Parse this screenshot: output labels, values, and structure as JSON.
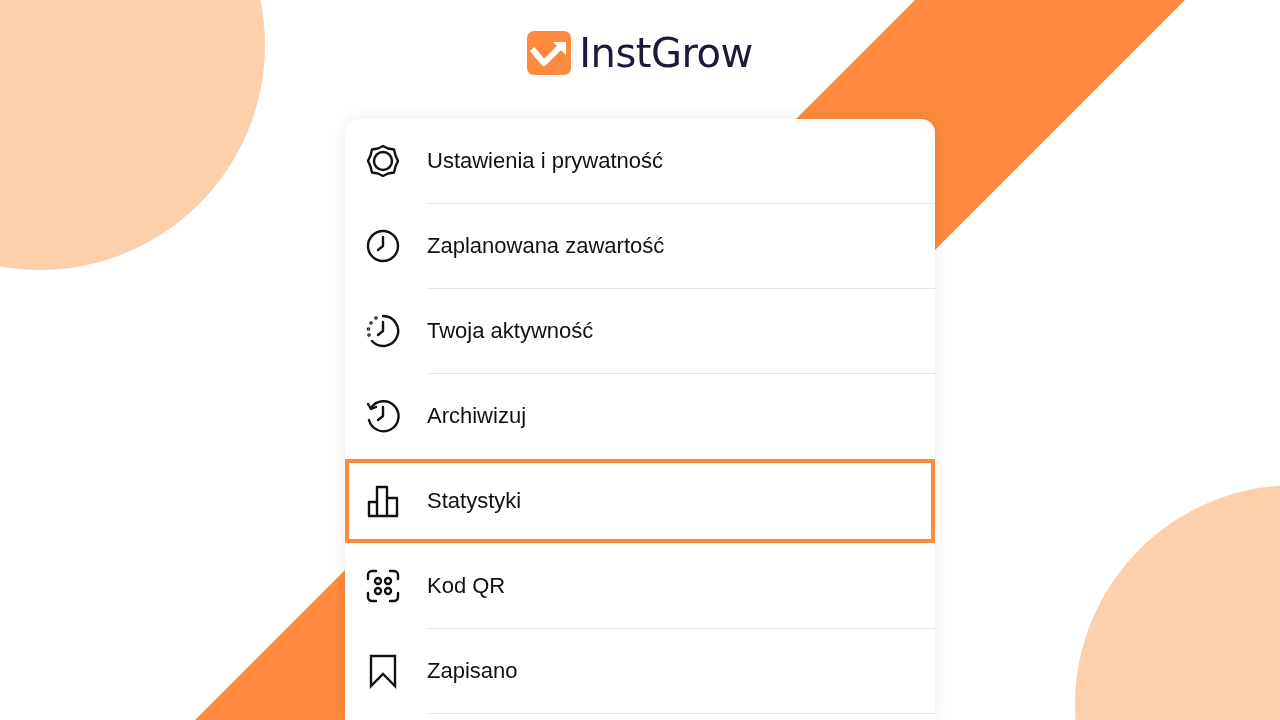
{
  "logo": {
    "text": "InstGrow"
  },
  "menu": {
    "items": [
      {
        "kind": "settings",
        "label": "Ustawienia i prywatność",
        "selected": false
      },
      {
        "kind": "clock",
        "label": "Zaplanowana zawartość",
        "selected": false
      },
      {
        "kind": "activity",
        "label": "Twoja aktywność",
        "selected": false
      },
      {
        "kind": "archive",
        "label": "Archiwizuj",
        "selected": false
      },
      {
        "kind": "stats",
        "label": "Statystyki",
        "selected": true
      },
      {
        "kind": "qr",
        "label": "Kod QR",
        "selected": false
      },
      {
        "kind": "saved",
        "label": "Zapisano",
        "selected": false
      }
    ]
  }
}
